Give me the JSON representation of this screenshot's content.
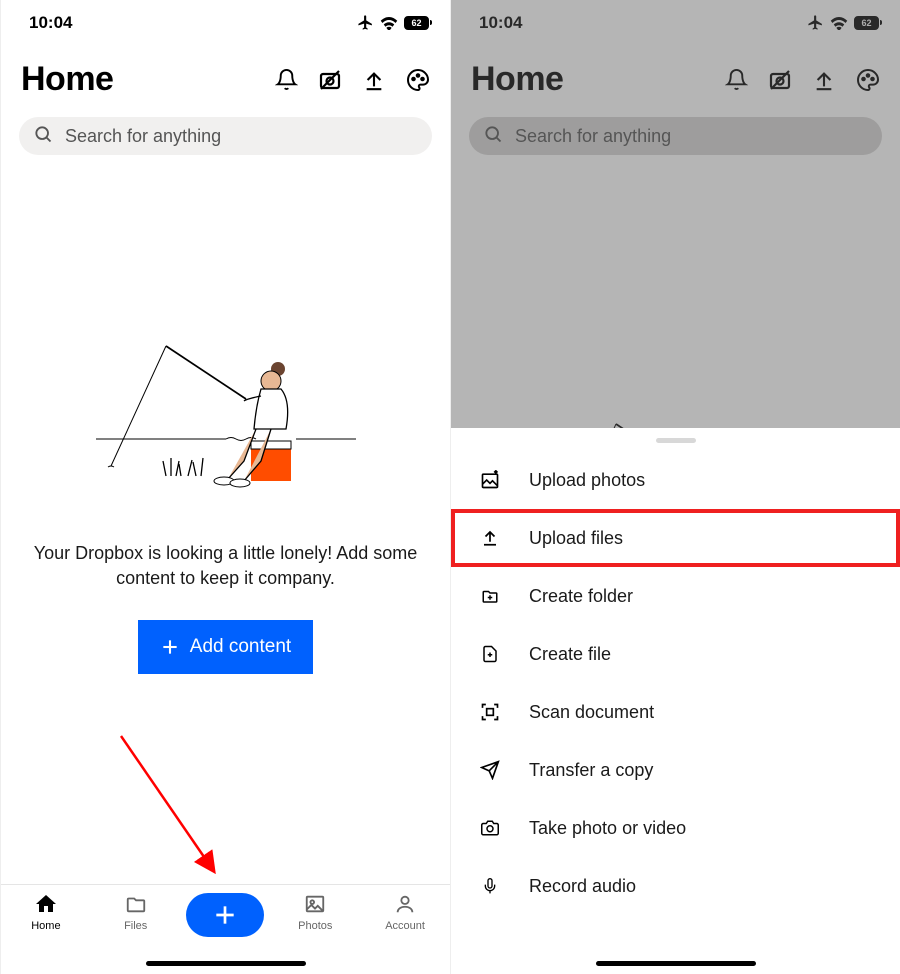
{
  "status": {
    "time": "10:04",
    "battery": "62"
  },
  "header": {
    "title": "Home"
  },
  "search": {
    "placeholder": "Search for anything"
  },
  "empty_state": {
    "message": "Your Dropbox is looking a little lonely! Add some content to keep it company.",
    "button_label": "Add content"
  },
  "nav": {
    "home": "Home",
    "files": "Files",
    "photos": "Photos",
    "account": "Account"
  },
  "sheet": {
    "items": [
      {
        "label": "Upload photos"
      },
      {
        "label": "Upload files"
      },
      {
        "label": "Create folder"
      },
      {
        "label": "Create file"
      },
      {
        "label": "Scan document"
      },
      {
        "label": "Transfer a copy"
      },
      {
        "label": "Take photo or video"
      },
      {
        "label": "Record audio"
      }
    ]
  }
}
